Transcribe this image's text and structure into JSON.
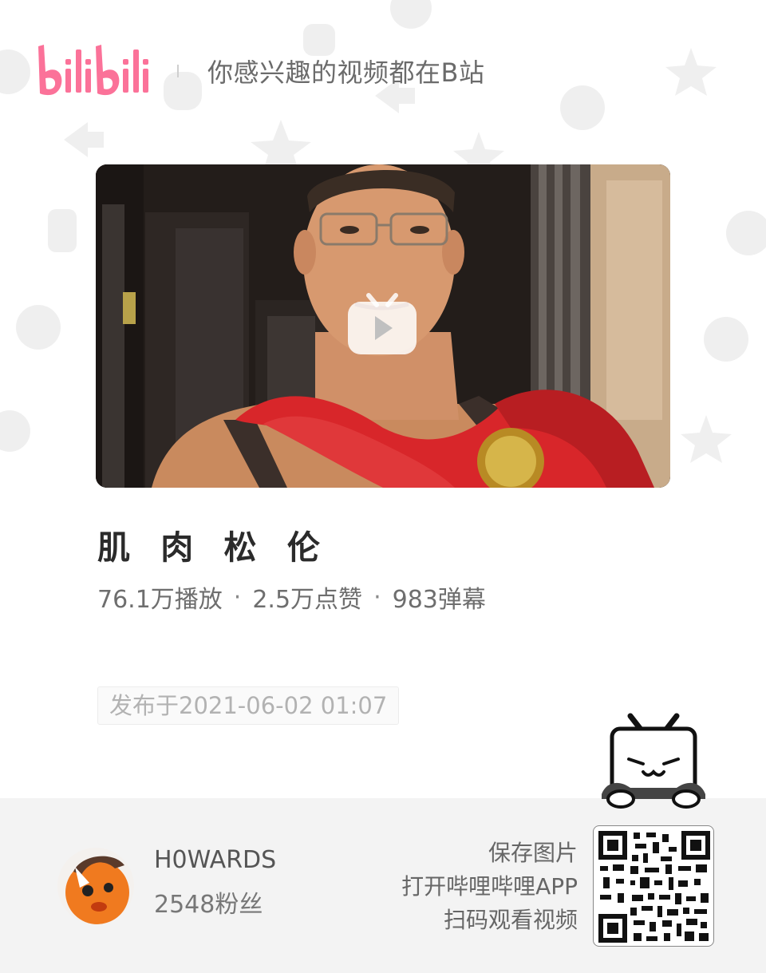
{
  "header": {
    "logo_text": "bilibili",
    "slogan": "你感兴趣的视频都在B站"
  },
  "video": {
    "title": "肌 肉 松 伦",
    "stats": {
      "plays": "76.1万播放",
      "likes": "2.5万点赞",
      "danmaku": "983弹幕",
      "separator": "·"
    },
    "publish_date": "发布于2021-06-02 01:07"
  },
  "uploader": {
    "name": "H0WARDS",
    "followers": "2548粉丝"
  },
  "cta": {
    "line1": "保存图片",
    "line2": "打开哔哩哔哩APP",
    "line3": "扫码观看视频"
  },
  "icons": {
    "play": "play-icon",
    "mascot": "tv-mascot-icon",
    "qr": "qr-code-icon"
  },
  "colors": {
    "brand_pink": "#fb7299",
    "footer_bg": "#f3f3f3",
    "cape_red": "#d8262a"
  }
}
